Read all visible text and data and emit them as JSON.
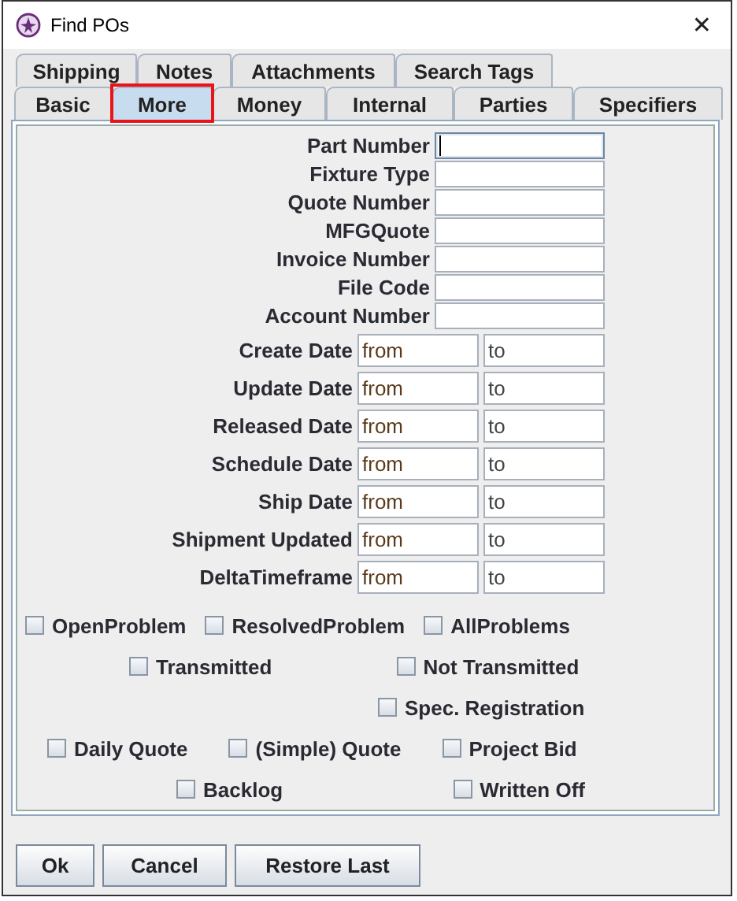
{
  "window": {
    "title": "Find POs",
    "close": "✕"
  },
  "tab_rows": [
    [
      {
        "label": "Shipping",
        "selected": false,
        "highlighted": false
      },
      {
        "label": "Notes",
        "selected": false,
        "highlighted": false
      },
      {
        "label": "Attachments",
        "selected": false,
        "highlighted": false
      },
      {
        "label": "Search Tags",
        "selected": false,
        "highlighted": false
      }
    ],
    [
      {
        "label": "Basic",
        "selected": false,
        "highlighted": false
      },
      {
        "label": "More",
        "selected": true,
        "highlighted": true
      },
      {
        "label": "Money",
        "selected": false,
        "highlighted": false
      },
      {
        "label": "Internal",
        "selected": false,
        "highlighted": false
      },
      {
        "label": "Parties",
        "selected": false,
        "highlighted": false
      },
      {
        "label": "Specifiers",
        "selected": false,
        "highlighted": false
      }
    ]
  ],
  "fields": [
    {
      "label": "Part Number",
      "kind": "text",
      "focused": true
    },
    {
      "label": "Fixture Type",
      "kind": "text",
      "focused": false
    },
    {
      "label": "Quote Number",
      "kind": "text",
      "focused": false
    },
    {
      "label": "MFGQuote",
      "kind": "text",
      "focused": false
    },
    {
      "label": "Invoice Number",
      "kind": "text",
      "focused": false
    },
    {
      "label": "File Code",
      "kind": "text",
      "focused": false
    },
    {
      "label": "Account Number",
      "kind": "text",
      "focused": false
    },
    {
      "label": "Create Date",
      "kind": "range",
      "from": "from",
      "to": "to"
    },
    {
      "label": "Update Date",
      "kind": "range",
      "from": "from",
      "to": "to"
    },
    {
      "label": "Released Date",
      "kind": "range",
      "from": "from",
      "to": "to"
    },
    {
      "label": "Schedule Date",
      "kind": "range",
      "from": "from",
      "to": "to"
    },
    {
      "label": "Ship Date",
      "kind": "range",
      "from": "from",
      "to": "to"
    },
    {
      "label": "Shipment Updated",
      "kind": "range",
      "from": "from",
      "to": "to"
    },
    {
      "label": "DeltaTimeframe",
      "kind": "range",
      "from": "from",
      "to": "to"
    }
  ],
  "checkbox_rows": [
    [
      {
        "label": "OpenProblem",
        "checked": false
      },
      {
        "label": "ResolvedProblem",
        "checked": false
      },
      {
        "label": "AllProblems",
        "checked": false
      }
    ],
    [
      {
        "label": "Transmitted",
        "checked": false
      },
      {
        "label": "Not Transmitted",
        "checked": false
      }
    ],
    [
      {
        "label": "Spec. Registration",
        "checked": false
      }
    ],
    [
      {
        "label": "Daily Quote",
        "checked": false
      },
      {
        "label": "(Simple) Quote",
        "checked": false
      },
      {
        "label": "Project Bid",
        "checked": false
      }
    ],
    [
      {
        "label": "Backlog",
        "checked": false
      },
      {
        "label": "Written Off",
        "checked": false
      }
    ]
  ],
  "buttons": [
    "Ok",
    "Cancel",
    "Restore Last"
  ]
}
